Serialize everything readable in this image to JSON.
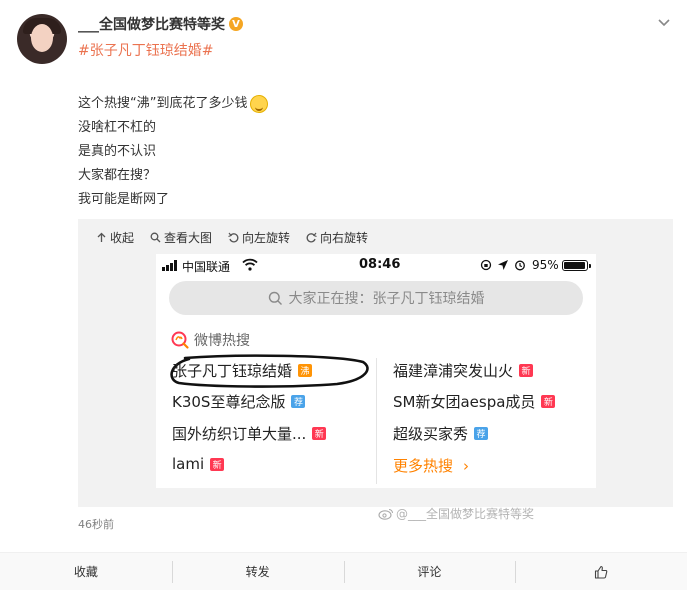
{
  "post": {
    "username": "___全国做梦比赛特等奖",
    "verified_badge": "V",
    "topic_tag": "#张子凡丁钰琼结婚#",
    "lines": [
      "这个热搜“沸”到底花了多少钱",
      "没啥杠不杠的",
      "是真的不认识",
      "大家都在搜？",
      "我可能是断网了"
    ],
    "time": "46秒前"
  },
  "media_tools": {
    "collapse": "收起",
    "view_large": "查看大图",
    "rotate_left": "向左旋转",
    "rotate_right": "向右旋转"
  },
  "phone": {
    "carrier": "中国联通",
    "clock": "08:46",
    "battery": "95%",
    "battery_level": 0.95,
    "search_placeholder": "大家正在搜：张子凡丁钰琼结婚",
    "hot_title": "微博热搜",
    "hot_left": [
      {
        "text": "张子凡丁钰琼结婚",
        "badge": "沸",
        "badge_color": "#ff9406"
      },
      {
        "text": "K30S至尊纪念版",
        "badge": "荐",
        "badge_color": "#4aa3e9"
      },
      {
        "text": "国外纺织订单大量...",
        "badge": "新",
        "badge_color": "#ff3852"
      },
      {
        "text": "lami",
        "badge": "新",
        "badge_color": "#ff3852"
      }
    ],
    "hot_right": [
      {
        "text": "福建漳浦突发山火",
        "badge": "新",
        "badge_color": "#ff3852"
      },
      {
        "text": "SM新女团aespa成员",
        "badge": "新",
        "badge_color": "#ff3852"
      },
      {
        "text": "超级买家秀",
        "badge": "荐",
        "badge_color": "#4aa3e9"
      }
    ],
    "more": "更多热搜",
    "more_arrow": "›",
    "watermark": "@___全国做梦比赛特等奖"
  },
  "footer": {
    "favorite": "收藏",
    "repost": "转发",
    "comment": "评论",
    "like_icon": "thumbs-up-icon"
  },
  "colors": {
    "topic": "#eb7350",
    "accent_orange": "#ff8200"
  }
}
